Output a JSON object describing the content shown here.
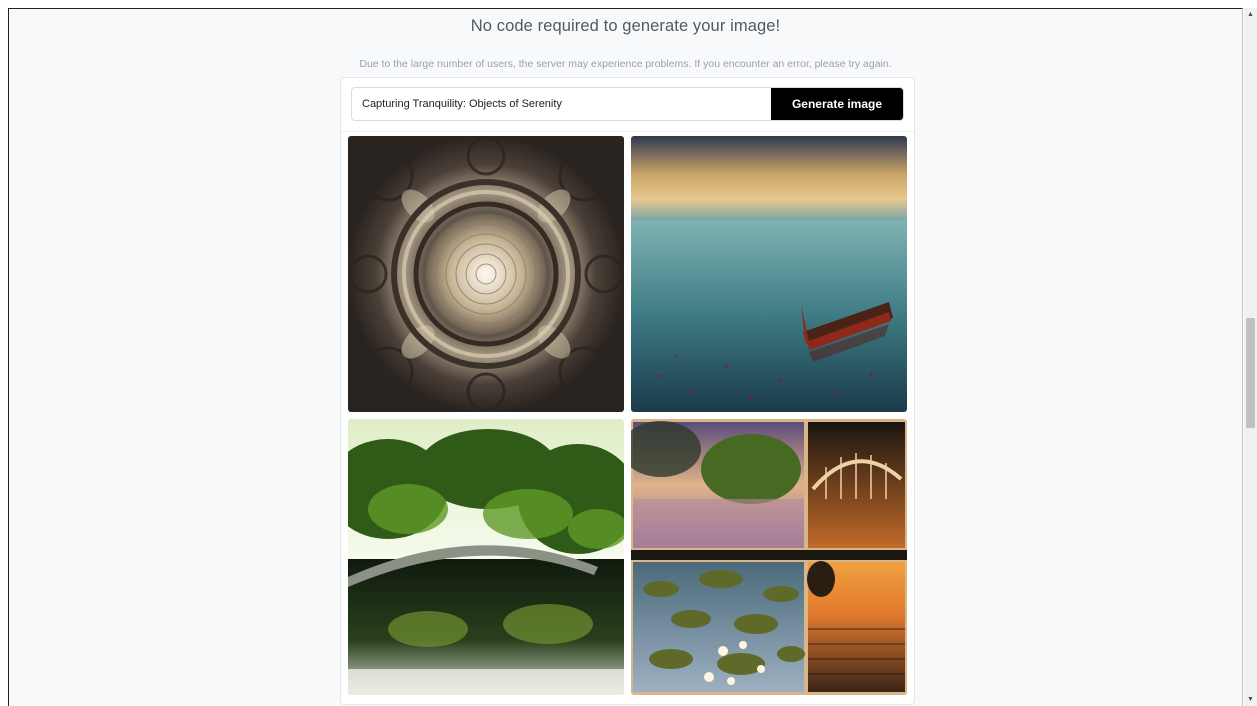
{
  "header": {
    "title": "No code required to generate your image!",
    "notice": "Due to the large number of users, the server may experience problems. If you encounter an error, please try again."
  },
  "prompt": {
    "value": "Capturing Tranquility: Objects of Serenity",
    "button_label": "Generate image"
  },
  "results": {
    "images": [
      {
        "subject": "sepia ornamental mandala with concentric circles"
      },
      {
        "subject": "small wooden boat on calm sea at dusk"
      },
      {
        "subject": "stone arch bridge over reflective garden pond"
      },
      {
        "subject": "collage of sunset lakes, footbridge and water lilies"
      }
    ]
  },
  "icons": {
    "scroll_up": "scroll-up-arrow-icon",
    "scroll_down": "scroll-down-arrow-icon"
  },
  "colors": {
    "button_bg": "#000000",
    "button_text": "#ffffff",
    "page_bg": "#f8f9fb",
    "heading_text": "#505a63",
    "notice_text": "#9aa2aa"
  }
}
